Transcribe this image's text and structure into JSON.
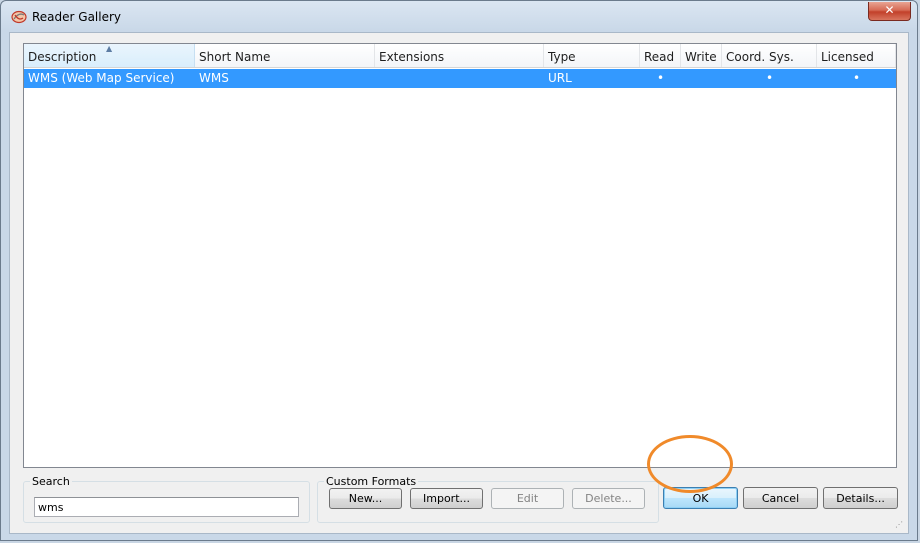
{
  "window": {
    "title": "Reader Gallery",
    "close_label": "✕"
  },
  "list": {
    "columns": [
      {
        "label": "Description"
      },
      {
        "label": "Short Name"
      },
      {
        "label": "Extensions"
      },
      {
        "label": "Type"
      },
      {
        "label": "Read"
      },
      {
        "label": "Write"
      },
      {
        "label": "Coord. Sys."
      },
      {
        "label": "Licensed"
      }
    ],
    "rows": [
      {
        "description": "WMS (Web Map Service)",
        "short_name": "WMS",
        "extensions": "",
        "type": "URL",
        "read": "•",
        "write": "",
        "coord_sys": "•",
        "licensed": "•",
        "selected": true
      }
    ]
  },
  "search": {
    "label": "Search",
    "value": "wms"
  },
  "custom_formats": {
    "label": "Custom Formats",
    "new_label": "New...",
    "import_label": "Import...",
    "edit_label": "Edit",
    "delete_label": "Delete..."
  },
  "actions": {
    "ok_label": "OK",
    "cancel_label": "Cancel",
    "details_label": "Details..."
  },
  "colors": {
    "selection": "#3399ff",
    "highlight_ring": "#f08a2a"
  }
}
